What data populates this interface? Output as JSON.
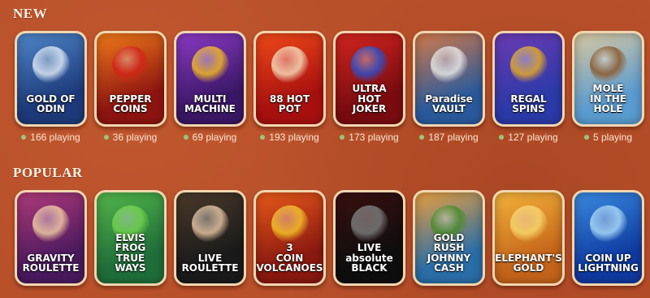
{
  "sections": {
    "new": {
      "title": "NEW",
      "games": [
        {
          "title": "GOLD OF\nODIN",
          "playing": "166 playing",
          "bg": "#1d3a7a",
          "bg2": "#4f86c9",
          "art": "#dce7f5"
        },
        {
          "title": "PEPPER\nCOINS",
          "playing": "36 playing",
          "bg": "#8e1410",
          "bg2": "#f07a1a",
          "art": "#d42417"
        },
        {
          "title": "MULTI\nMACHINE",
          "playing": "69 playing",
          "bg": "#3a1766",
          "bg2": "#8b3ac4",
          "art": "#f2b91f"
        },
        {
          "title": "88 HOT\nPOT",
          "playing": "193 playing",
          "bg": "#a8100f",
          "bg2": "#f04a1a",
          "art": "#f3d8b8"
        },
        {
          "title": "ULTRA\nHOT\nJOKER",
          "playing": "173 playing",
          "bg": "#7a0c10",
          "bg2": "#d3251f",
          "art": "#2c4fc9"
        },
        {
          "title": "Paradise\nVAULT",
          "playing": "187 playing",
          "bg": "#2a5a9c",
          "bg2": "#d27a4a",
          "art": "#e6e6e6"
        },
        {
          "title": "REGAL\nSPINS",
          "playing": "127 playing",
          "bg": "#2b3aa8",
          "bg2": "#6d3bb5",
          "art": "#e3aa25"
        },
        {
          "title": "MOLE\nIN THE\nHOLE",
          "playing": "5 playing",
          "bg": "#5a9cd1",
          "bg2": "#d9c8a0",
          "art": "#8b5a2e"
        }
      ]
    },
    "popular": {
      "title": "POPULAR",
      "games": [
        {
          "title": "GRAVITY\nROULETTE",
          "bg": "#4a1a5e",
          "bg2": "#b03a7a",
          "art": "#f0c9a0"
        },
        {
          "title": "ELVIS FROG\nTRUE WAYS",
          "bg": "#1f6e3a",
          "bg2": "#52b54a",
          "art": "#6fd24a"
        },
        {
          "title": "LIVE\nROULETTE",
          "bg": "#1a1a1a",
          "bg2": "#4a3a2a",
          "art": "#e3c3a0"
        },
        {
          "title": "3\nCOIN\nVOLCANOES",
          "bg": "#8a1810",
          "bg2": "#e85a1a",
          "art": "#f3c228"
        },
        {
          "title": "LIVE\nabsolute\nBLACK",
          "bg": "#0e0e0e",
          "bg2": "#3a1010",
          "art": "#7a7a7a"
        },
        {
          "title": "GOLD RUSH\nJOHNNY CASH",
          "bg": "#2a6ea8",
          "bg2": "#e8a040",
          "art": "#4a8a2a"
        },
        {
          "title": "ELEPHANT'S\nGOLD",
          "bg": "#c4641a",
          "bg2": "#f4b33a",
          "art": "#f7d66a"
        },
        {
          "title": "COIN UP\nLIGHTNING",
          "bg": "#0f3aa0",
          "bg2": "#3a8ae0",
          "art": "#a7d8f5"
        }
      ]
    }
  },
  "colors": {
    "background": "#b8502a",
    "online_dot": "#9bc57a"
  }
}
